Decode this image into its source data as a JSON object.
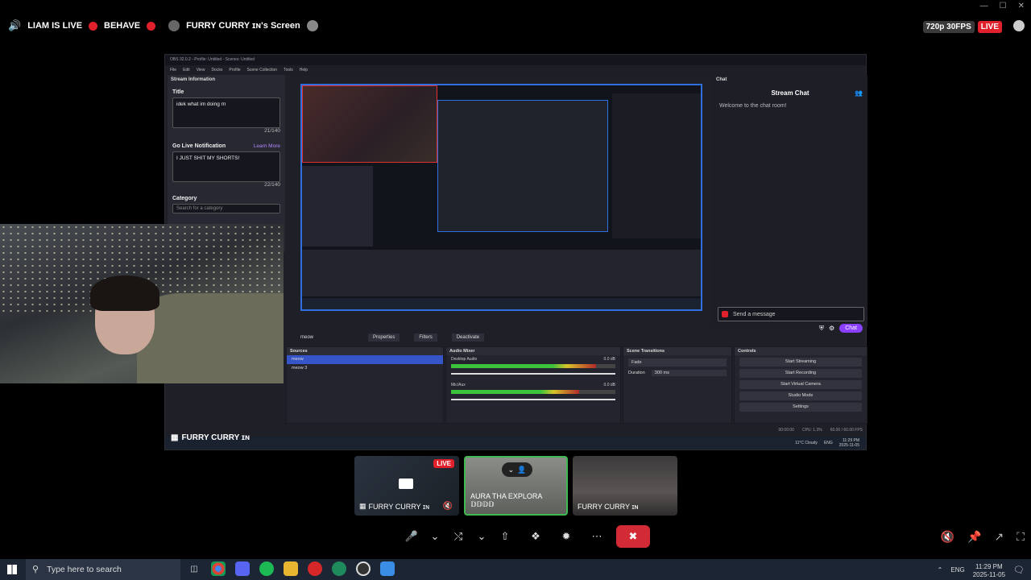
{
  "topbar": {
    "stream_title": "LIAM IS LIVE",
    "stream_tag": "BEHAVE",
    "screen_owner": "FURRY CURRY ɪɴ's Screen",
    "quality": "720p 30FPS",
    "live_badge": "LIVE"
  },
  "obs": {
    "window_title": "OBS 32.0.2 - Profile: Untitled - Scenes: Untitled",
    "menu": [
      "File",
      "Edit",
      "View",
      "Docks",
      "Profile",
      "Scene Collection",
      "Tools",
      "Help"
    ],
    "stream_info": {
      "header": "Stream Information",
      "title_label": "Title",
      "title_value": "idek what im doing rn",
      "title_count": "21/140",
      "golive_label": "Go Live Notification",
      "learn_more": "Learn More",
      "golive_value": "I JUST SHIT MY SHORTS!",
      "golive_count": "22/140",
      "category_label": "Category",
      "category_placeholder": "Search for a category"
    },
    "chat": {
      "dock_header": "Chat",
      "title": "Stream Chat",
      "welcome": "Welcome to the chat room!",
      "send_placeholder": "Send a message",
      "chat_button": "Chat"
    },
    "scene_toolbar": {
      "source_name": "meow",
      "properties": "Properties",
      "filters": "Filters",
      "deactivate": "Deactivate"
    },
    "sources": {
      "header": "Sources",
      "items": [
        "meow",
        "meow 3"
      ]
    },
    "audio_mixer": {
      "header": "Audio Mixer",
      "channels": [
        {
          "name": "Desktop Audio",
          "db": "0.0 dB",
          "level": 0.88
        },
        {
          "name": "Mic/Aux",
          "db": "0.0 dB",
          "level": 0.78
        }
      ]
    },
    "scene_transitions": {
      "header": "Scene Transitions",
      "transition": "Fade",
      "duration_label": "Duration",
      "duration_value": "300 ms"
    },
    "controls": {
      "header": "Controls",
      "buttons": [
        "Start Streaming",
        "Start Recording",
        "Start Virtual Camera",
        "Studio Mode",
        "Settings"
      ]
    },
    "statusbar": {
      "time": "00:00:00",
      "cpu": "CPU: 1.3%",
      "fps": "60.00 / 60.00 FPS"
    },
    "inner_taskbar": {
      "weather": "11°C Cloudy",
      "lang": "ENG",
      "clock_time": "11:29 PM",
      "clock_date": "2025-11-05"
    }
  },
  "webcam": {
    "label": "FURRY CURRY ɪɴ"
  },
  "tiles": [
    {
      "label": "FURRY CURRY ɪɴ",
      "live": "LIVE"
    },
    {
      "label": "AURA THA EXPLORA 𝔻𝔻𝔻𝔻"
    },
    {
      "label": "FURRY CURRY ɪɴ"
    }
  ],
  "taskbar": {
    "search_placeholder": "Type here to search",
    "lang": "ENG",
    "time": "11:29 PM",
    "date": "2025-11-05"
  },
  "colors": {
    "live_red": "#e0202a",
    "obs_blue": "#2f6fe0",
    "twitch_purple": "#8b3fff",
    "end_call": "#d22b35"
  }
}
